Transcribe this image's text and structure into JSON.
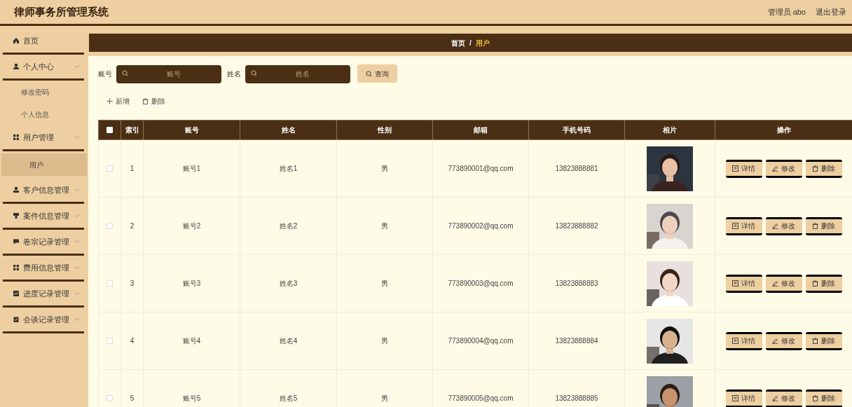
{
  "header": {
    "title": "律师事务所管理系统",
    "user": "管理员 abo",
    "logout": "退出登录"
  },
  "menu": [
    {
      "label": "首页",
      "chevron": false
    },
    {
      "label": "个人中心",
      "chevron": true,
      "children": [
        {
          "label": "修改密码",
          "selected": false
        },
        {
          "label": "个人信息",
          "selected": false
        }
      ]
    },
    {
      "label": "用户管理",
      "chevron": true,
      "children": [
        {
          "label": "用户",
          "selected": true
        }
      ]
    },
    {
      "label": "客户信息管理",
      "chevron": true
    },
    {
      "label": "案件信息管理",
      "chevron": true
    },
    {
      "label": "卷宗记录管理",
      "chevron": true
    },
    {
      "label": "费用信息管理",
      "chevron": true
    },
    {
      "label": "进度记录管理",
      "chevron": true
    },
    {
      "label": "会谈记录管理",
      "chevron": true
    }
  ],
  "breadcrumb": {
    "items": [
      "首页",
      "用户"
    ],
    "separator": "/"
  },
  "search": {
    "fields": [
      {
        "label": "账号",
        "placeholder": "账号"
      },
      {
        "label": "姓名",
        "placeholder": "姓名"
      }
    ],
    "button": "查询"
  },
  "toolbar": [
    "新增",
    "删除"
  ],
  "table": {
    "select_all_checked": false,
    "columns": [
      "索引",
      "账号",
      "姓名",
      "性别",
      "邮箱",
      "手机号码",
      "相片",
      "操作"
    ],
    "rows": [
      {
        "checked": false,
        "index": "1",
        "account": "账号1",
        "name": "姓名1",
        "gender": "男",
        "email": "773890001@qq.com",
        "phone": "13823888881",
        "actions": [
          "详情",
          "修改",
          "删除"
        ]
      },
      {
        "checked": false,
        "index": "2",
        "account": "账号2",
        "name": "姓名2",
        "gender": "男",
        "email": "773890002@qq.com",
        "phone": "13823888882",
        "actions": [
          "详情",
          "修改",
          "删除"
        ]
      },
      {
        "checked": false,
        "index": "3",
        "account": "账号3",
        "name": "姓名3",
        "gender": "男",
        "email": "773890003@qq.com",
        "phone": "13823888883",
        "actions": [
          "详情",
          "修改",
          "删除"
        ]
      },
      {
        "checked": false,
        "index": "4",
        "account": "账号4",
        "name": "姓名4",
        "gender": "男",
        "email": "773890004@qq.com",
        "phone": "13823888884",
        "actions": [
          "详情",
          "修改",
          "删除"
        ]
      },
      {
        "checked": false,
        "index": "5",
        "account": "账号5",
        "name": "姓名5",
        "gender": "男",
        "email": "773890005@qq.com",
        "phone": "13823888885",
        "actions": [
          "详情",
          "修改",
          "删除"
        ]
      }
    ]
  }
}
